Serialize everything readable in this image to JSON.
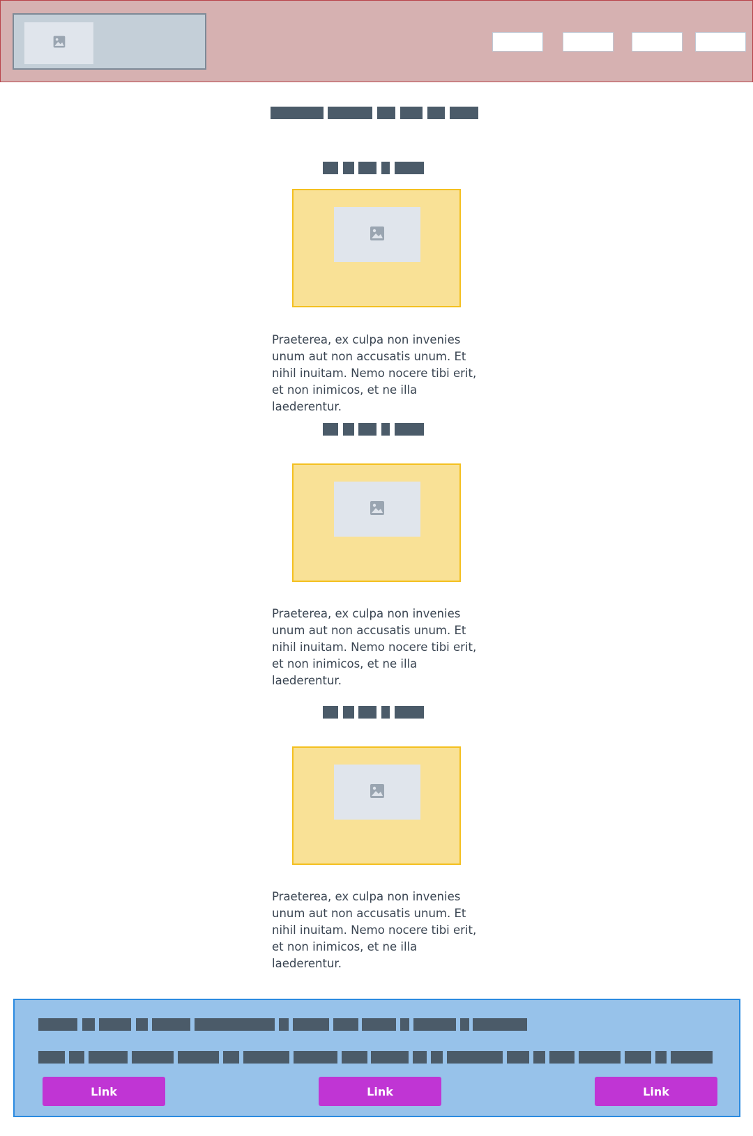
{
  "header": {
    "logo_icon": "image-icon",
    "nav_items": [
      "",
      "",
      "",
      ""
    ]
  },
  "main": {
    "sections": [
      {
        "image_icon": "image-icon",
        "text": "Praeterea, ex culpa non invenies unum aut non accusatis unum. Et nihil inuitam. Nemo nocere tibi erit, et non inimicos, et ne illa laederentur."
      },
      {
        "image_icon": "image-icon",
        "text": "Praeterea, ex culpa non invenies unum aut non accusatis unum. Et nihil inuitam. Nemo nocere tibi erit, et non inimicos, et ne illa laederentur."
      },
      {
        "image_icon": "image-icon",
        "text": "Praeterea, ex culpa non invenies unum aut non accusatis unum. Et nihil inuitam. Nemo nocere tibi erit, et non inimicos, et ne illa laederentur."
      }
    ]
  },
  "footer": {
    "links": [
      "Link",
      "Link",
      "Link"
    ]
  },
  "colors": {
    "header_bg": "#d6b1b1",
    "header_border": "#b8434a",
    "card_bg": "#f9e196",
    "card_border": "#f4c020",
    "footer_bg": "#97c2ea",
    "footer_border": "#2a8ae0",
    "link_button": "#c035d4",
    "skeleton_text": "#4b5b69"
  }
}
